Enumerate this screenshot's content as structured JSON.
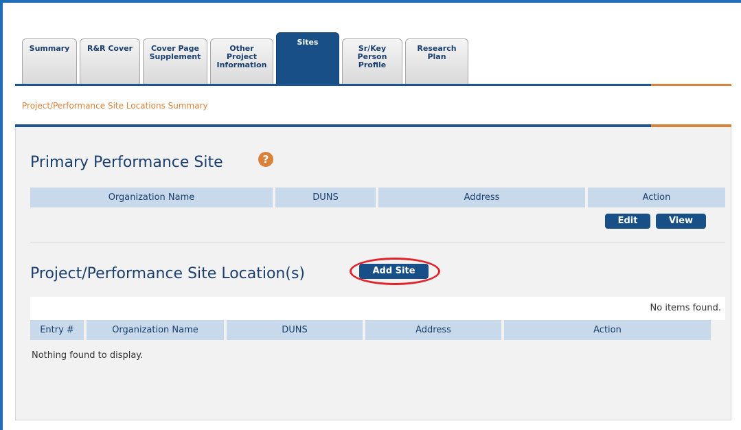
{
  "tabs": [
    {
      "label": "Summary",
      "active": false
    },
    {
      "label": "R&R Cover",
      "active": false
    },
    {
      "label": "Cover Page\nSupplement",
      "active": false
    },
    {
      "label": "Other\nProject\nInformation",
      "active": false
    },
    {
      "label": "Sites",
      "active": true
    },
    {
      "label": "Sr/Key\nPerson\nProfile",
      "active": false
    },
    {
      "label": "Research\nPlan",
      "active": false
    }
  ],
  "section_header": "Project/Performance Site Locations Summary",
  "primary": {
    "title": "Primary Performance Site",
    "help_icon": "?",
    "columns": [
      "Organization Name",
      "DUNS",
      "Address",
      "Action"
    ],
    "edit_label": "Edit",
    "view_label": "View"
  },
  "locations": {
    "title": "Project/Performance Site Location(s)",
    "add_label": "Add Site",
    "no_items": "No items found.",
    "columns": [
      "Entry #",
      "Organization Name",
      "DUNS",
      "Address",
      "Action"
    ],
    "empty_message": "Nothing found to display."
  },
  "colors": {
    "frame": "#1e6fb8",
    "navy": "#174f86",
    "orange": "#d9823b",
    "header_cell": "#c7d9ea",
    "annotation": "#e0222a"
  }
}
